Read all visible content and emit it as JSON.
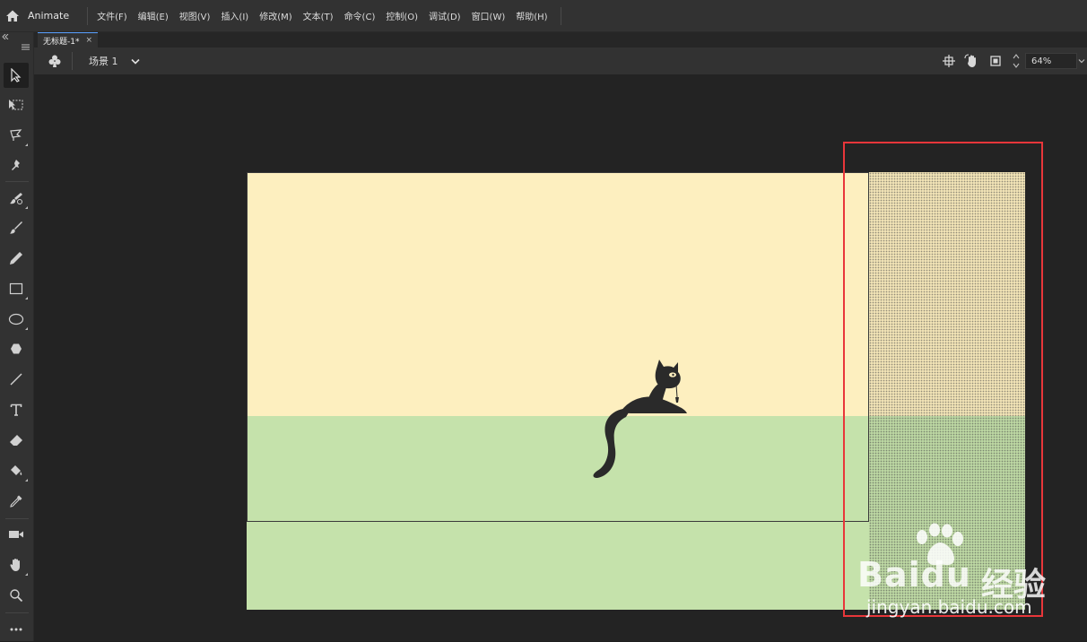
{
  "app": {
    "name": "Animate"
  },
  "menu": {
    "items": [
      "文件(F)",
      "编辑(E)",
      "视图(V)",
      "插入(I)",
      "修改(M)",
      "文本(T)",
      "命令(C)",
      "控制(O)",
      "调试(D)",
      "窗口(W)",
      "帮助(H)"
    ]
  },
  "document_tab": {
    "title": "无标题-1*",
    "close": "×"
  },
  "scene_bar": {
    "scene_label": "场景 1",
    "zoom_value": "64%"
  },
  "toolbar": {
    "tools": [
      {
        "name": "selection-tool",
        "icon": "arrow-icon",
        "selected": true
      },
      {
        "name": "free-transform-tool",
        "icon": "transform-icon"
      },
      {
        "name": "lasso-tool",
        "icon": "lasso-icon"
      },
      {
        "name": "asset-warp-tool",
        "icon": "pin-icon"
      },
      {
        "name": "paint-brush-tool",
        "icon": "brush-icon"
      },
      {
        "name": "brush-tool",
        "icon": "brush-fluid-icon"
      },
      {
        "name": "pencil-tool",
        "icon": "pencil-icon"
      },
      {
        "name": "rectangle-tool",
        "icon": "rectangle-icon"
      },
      {
        "name": "oval-tool",
        "icon": "oval-icon"
      },
      {
        "name": "polystar-tool",
        "icon": "polygon-icon"
      },
      {
        "name": "line-tool",
        "icon": "line-icon"
      },
      {
        "name": "text-tool",
        "icon": "text-icon"
      },
      {
        "name": "eraser-tool",
        "icon": "eraser-icon"
      },
      {
        "name": "paint-bucket-tool",
        "icon": "bucket-icon"
      },
      {
        "name": "eyedropper-tool",
        "icon": "eyedropper-icon"
      },
      {
        "name": "camera-tool",
        "icon": "camera-icon"
      },
      {
        "name": "hand-tool",
        "icon": "hand-icon"
      },
      {
        "name": "zoom-tool",
        "icon": "magnifier-icon"
      },
      {
        "name": "more-tools",
        "icon": "ellipsis-icon"
      }
    ]
  },
  "stage": {
    "sky_color": "#fdefbf",
    "ground_color": "#c5e2ab",
    "highlight_color": "#e8363a"
  },
  "watermark": {
    "brand": "Bai",
    "brand_du": "du",
    "brand_cn": "经验",
    "url": "jingyan.baidu.com"
  }
}
